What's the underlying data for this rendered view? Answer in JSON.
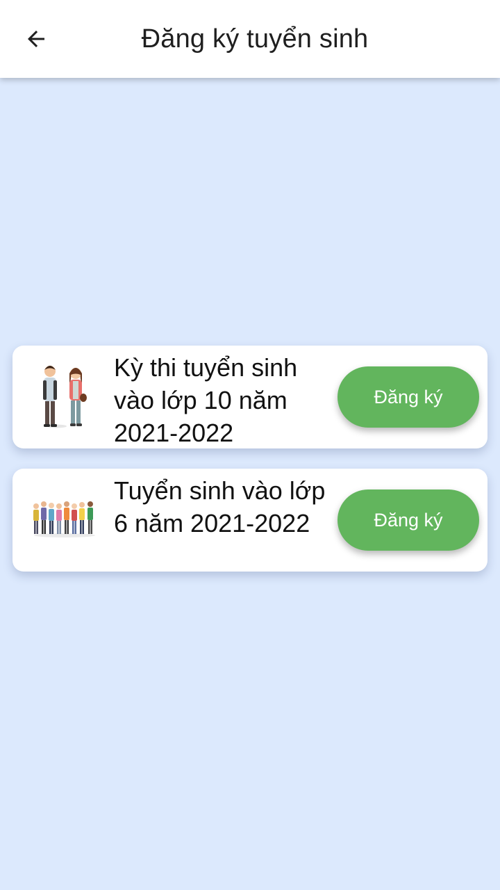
{
  "appbar": {
    "title": "Đăng ký tuyển sinh",
    "back_icon": "arrow-left-icon"
  },
  "colors": {
    "background": "#dce9fd",
    "appbar": "#ffffff",
    "button": "#62b55d",
    "button_text": "#ffffff"
  },
  "registrations": [
    {
      "title": "Kỳ thi tuyển sinh vào lớp 10 năm 2021-2022",
      "image_icon": "two-students-illustration",
      "button_label": "Đăng ký"
    },
    {
      "title": "Tuyển sinh vào lớp 6 năm 2021-2022",
      "image_icon": "group-of-students-illustration",
      "button_label": "Đăng ký"
    }
  ]
}
